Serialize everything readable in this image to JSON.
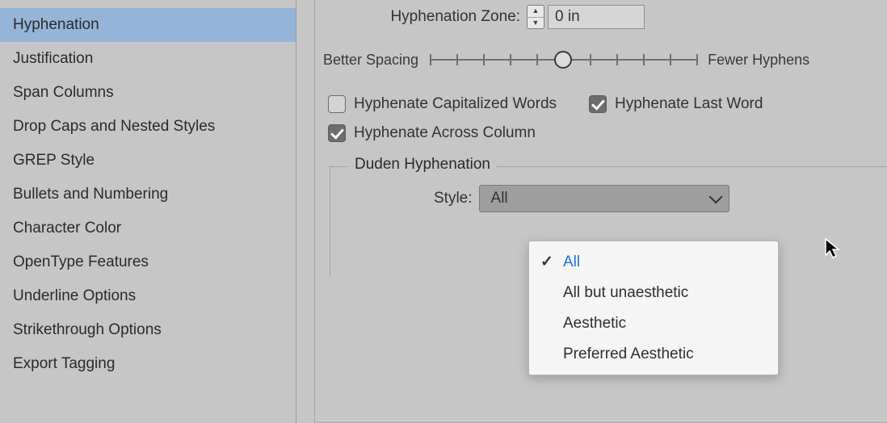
{
  "sidebar": {
    "items": [
      {
        "label": "Hyphenation",
        "selected": true
      },
      {
        "label": "Justification"
      },
      {
        "label": "Span Columns"
      },
      {
        "label": "Drop Caps and Nested Styles"
      },
      {
        "label": "GREP Style"
      },
      {
        "label": "Bullets and Numbering"
      },
      {
        "label": "Character Color"
      },
      {
        "label": "OpenType Features"
      },
      {
        "label": "Underline Options"
      },
      {
        "label": "Strikethrough Options"
      },
      {
        "label": "Export Tagging"
      }
    ]
  },
  "panel": {
    "hyphenation_zone_label": "Hyphenation Zone:",
    "hyphenation_zone_value": "0 in",
    "slider": {
      "left_label": "Better Spacing",
      "right_label": "Fewer Hyphens",
      "ticks": 11,
      "position_percent": 50
    },
    "checkboxes": {
      "capitalized": {
        "label": "Hyphenate Capitalized Words",
        "checked": false
      },
      "last_word": {
        "label": "Hyphenate Last Word",
        "checked": true
      },
      "across_col": {
        "label": "Hyphenate Across Column",
        "checked": true
      }
    },
    "duden": {
      "legend": "Duden Hyphenation",
      "style_label": "Style:",
      "selected": "All",
      "options": [
        "All",
        "All but unaesthetic",
        "Aesthetic",
        "Preferred Aesthetic"
      ]
    }
  }
}
